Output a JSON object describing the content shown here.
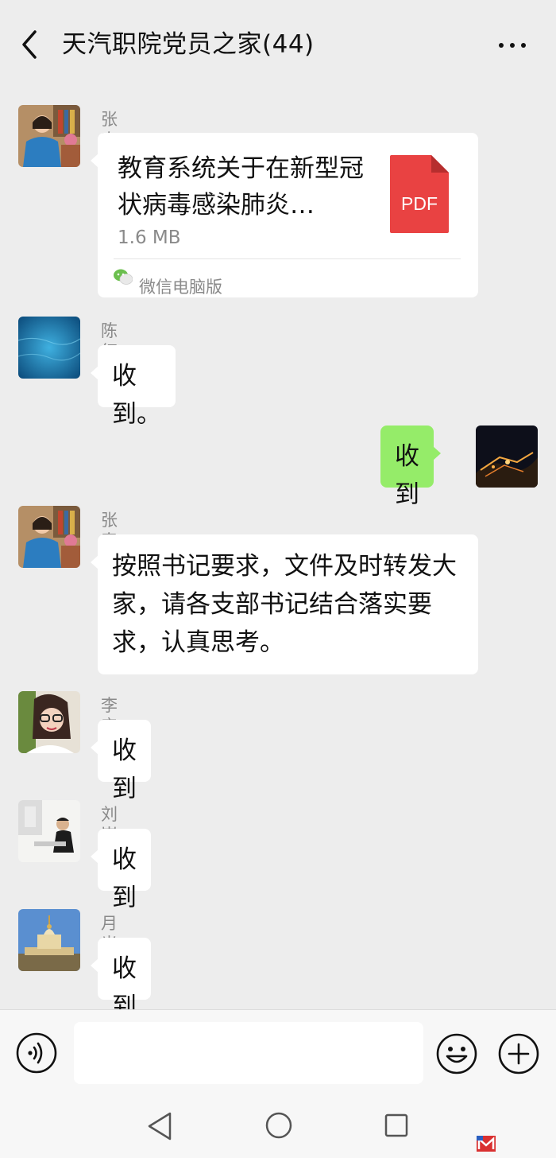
{
  "header": {
    "title": "天汽职院党员之家(44)",
    "back_icon": "chevron-left-icon",
    "more_icon": "more-horizontal-icon"
  },
  "messages": [
    {
      "sender": "张春红",
      "type": "file",
      "file": {
        "title": "教育系统关于在新型冠状病毒感染肺炎…",
        "size": "1.6 MB",
        "icon_label": "PDF",
        "source": "微信电脑版"
      }
    },
    {
      "sender": "陈红",
      "type": "text",
      "text": "收到。"
    },
    {
      "sender": "",
      "type": "text",
      "self": true,
      "text": "收到"
    },
    {
      "sender": "张春红",
      "type": "text",
      "text": "按照书记要求，文件及时转发大家，请各支部书记结合落实要求，认真思考。"
    },
    {
      "sender": "李彦霞",
      "type": "text",
      "text": "收到"
    },
    {
      "sender": "刘嵩",
      "type": "text",
      "text": "收到"
    },
    {
      "sender": "月光",
      "type": "text",
      "text": "收到"
    }
  ],
  "input_bar": {
    "voice_icon": "voice-icon",
    "emoji_icon": "emoji-icon",
    "plus_icon": "plus-icon"
  },
  "nav_bar": {
    "back_icon": "triangle-back-icon",
    "home_icon": "circle-home-icon",
    "recent_icon": "square-recents-icon"
  },
  "colors": {
    "background": "#ededed",
    "bubble_self": "#95ec69",
    "bubble_other": "#ffffff",
    "pdf_red": "#e94242"
  }
}
